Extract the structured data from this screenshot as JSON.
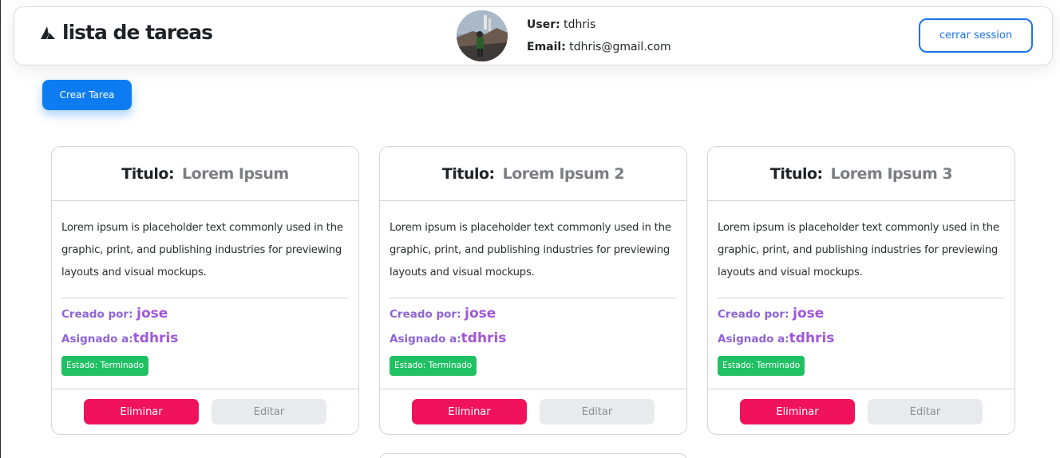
{
  "header": {
    "title": "lista de tareas",
    "user_label": "User:",
    "user_value": "tdhris",
    "email_label": "Email:",
    "email_value": "tdhris@gmail.com",
    "logout_label": "cerrar session"
  },
  "toolbar": {
    "create_label": "Crear Tarea"
  },
  "cards": [
    {
      "title_label": "Titulo:",
      "title_value": "Lorem Ipsum",
      "description": "Lorem ipsum is placeholder text commonly used in the graphic, print, and publishing industries for previewing layouts and visual mockups.",
      "created_label": "Creado por:",
      "created_value": "jose",
      "assigned_label": "Asignado a:",
      "assigned_value": "tdhris",
      "status": "Estado: Terminado",
      "delete_label": "Eliminar",
      "edit_label": "Editar"
    },
    {
      "title_label": "Titulo:",
      "title_value": "Lorem Ipsum 2",
      "description": "Lorem ipsum is placeholder text commonly used in the graphic, print, and publishing industries for previewing layouts and visual mockups.",
      "created_label": "Creado por:",
      "created_value": "jose",
      "assigned_label": "Asignado a:",
      "assigned_value": "tdhris",
      "status": "Estado: Terminado",
      "delete_label": "Eliminar",
      "edit_label": "Editar"
    },
    {
      "title_label": "Titulo:",
      "title_value": "Lorem Ipsum 3",
      "description": "Lorem ipsum is placeholder text commonly used in the graphic, print, and publishing industries for previewing layouts and visual mockups.",
      "created_label": "Creado por:",
      "created_value": "jose",
      "assigned_label": "Asignado a:",
      "assigned_value": "tdhris",
      "status": "Estado: Terminado",
      "delete_label": "Eliminar",
      "edit_label": "Editar"
    }
  ],
  "colors": {
    "primary": "#0d7cf2",
    "danger": "#f0125d",
    "success": "#21c063",
    "meta": "#8e63d8"
  }
}
